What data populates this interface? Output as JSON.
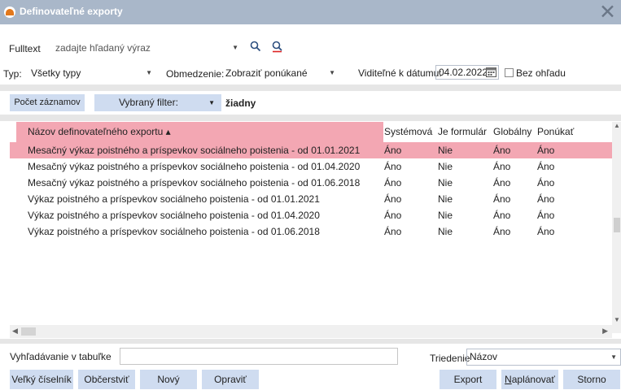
{
  "window": {
    "title": "Definovateľné exporty"
  },
  "filters": {
    "fulltext_label": "Fulltext",
    "fulltext_placeholder": "zadajte hľadaný výraz",
    "type_label": "Typ:",
    "type_value": "Všetky typy",
    "restriction_label": "Obmedzenie:",
    "restriction_value": "Zobraziť ponúkané",
    "visible_date_label": "Viditeľné k dátumu:",
    "visible_date_value": "04.02.2022",
    "ignore_label": "Bez ohľadu",
    "ignore_checked": false
  },
  "toolbar": {
    "count_button": "Počet záznamov",
    "filter_label": "Vybraný filter:",
    "filter_value": "žiadny"
  },
  "table": {
    "columns": [
      "Názov definovateľného exportu ▴",
      "Systémová",
      "Je formulár",
      "Globálny",
      "Ponúkať"
    ],
    "sorted_column": 0,
    "selected_row": 0,
    "rows": [
      [
        "Mesačný výkaz poistného a príspevkov sociálneho poistenia - od 01.01.2021",
        "Áno",
        "Nie",
        "Áno",
        "Áno"
      ],
      [
        "Mesačný výkaz poistného a príspevkov sociálneho poistenia - od 01.04.2020",
        "Áno",
        "Nie",
        "Áno",
        "Áno"
      ],
      [
        "Mesačný výkaz poistného a príspevkov sociálneho poistenia - od 01.06.2018",
        "Áno",
        "Nie",
        "Áno",
        "Áno"
      ],
      [
        "Výkaz poistného a príspevkov sociálneho poistenia - od 01.01.2021",
        "Áno",
        "Nie",
        "Áno",
        "Áno"
      ],
      [
        "Výkaz poistného a príspevkov sociálneho poistenia - od 01.04.2020",
        "Áno",
        "Nie",
        "Áno",
        "Áno"
      ],
      [
        "Výkaz poistného a príspevkov sociálneho poistenia - od 01.06.2018",
        "Áno",
        "Nie",
        "Áno",
        "Áno"
      ]
    ]
  },
  "table_search": {
    "label": "Vyhľadávanie v tabuľke",
    "value": "",
    "sort_label": "Triedenie",
    "sort_value": "Názov"
  },
  "buttons": {
    "big_dictionary": "Veľký číselník",
    "refresh": "Občerstviť",
    "new": "Nový",
    "edit": "Opraviť",
    "export": "Export",
    "schedule_prefix": "N",
    "schedule_rest": "aplánovať",
    "cancel": "Storno"
  },
  "colors": {
    "titlebar": "#a9b7c9",
    "button": "#cfdcf0",
    "selection": "#f3a7b3",
    "logo_accent": "#e2781d"
  },
  "icons": [
    "app-logo-icon",
    "close-icon",
    "search-icon",
    "clear-search-icon",
    "calendar-icon",
    "chevron-down-icon"
  ]
}
